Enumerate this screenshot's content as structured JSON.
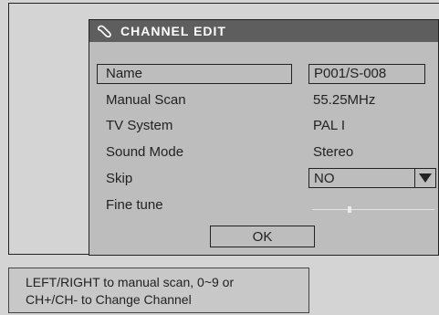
{
  "dialog": {
    "title": "CHANNEL EDIT",
    "title_icon": "wrench-icon",
    "rows": {
      "name": {
        "label": "Name",
        "value": "P001/S-008"
      },
      "manual_scan": {
        "label": "Manual Scan",
        "value": "55.25MHz"
      },
      "tv_system": {
        "label": "TV System",
        "value": "PAL I"
      },
      "sound_mode": {
        "label": "Sound Mode",
        "value": "Stereo"
      },
      "skip": {
        "label": "Skip",
        "value": "NO"
      },
      "fine_tune": {
        "label": "Fine tune",
        "level": 0.3
      }
    },
    "ok_label": "OK"
  },
  "help": {
    "line1": "LEFT/RIGHT to manual scan, 0~9 or",
    "line2": "CH+/CH- to Change Channel"
  },
  "colors": {
    "background": "#d4d4d4",
    "dialog": "#bdbdbd",
    "titlebar": "#5e5e5e",
    "text": "#222222"
  }
}
